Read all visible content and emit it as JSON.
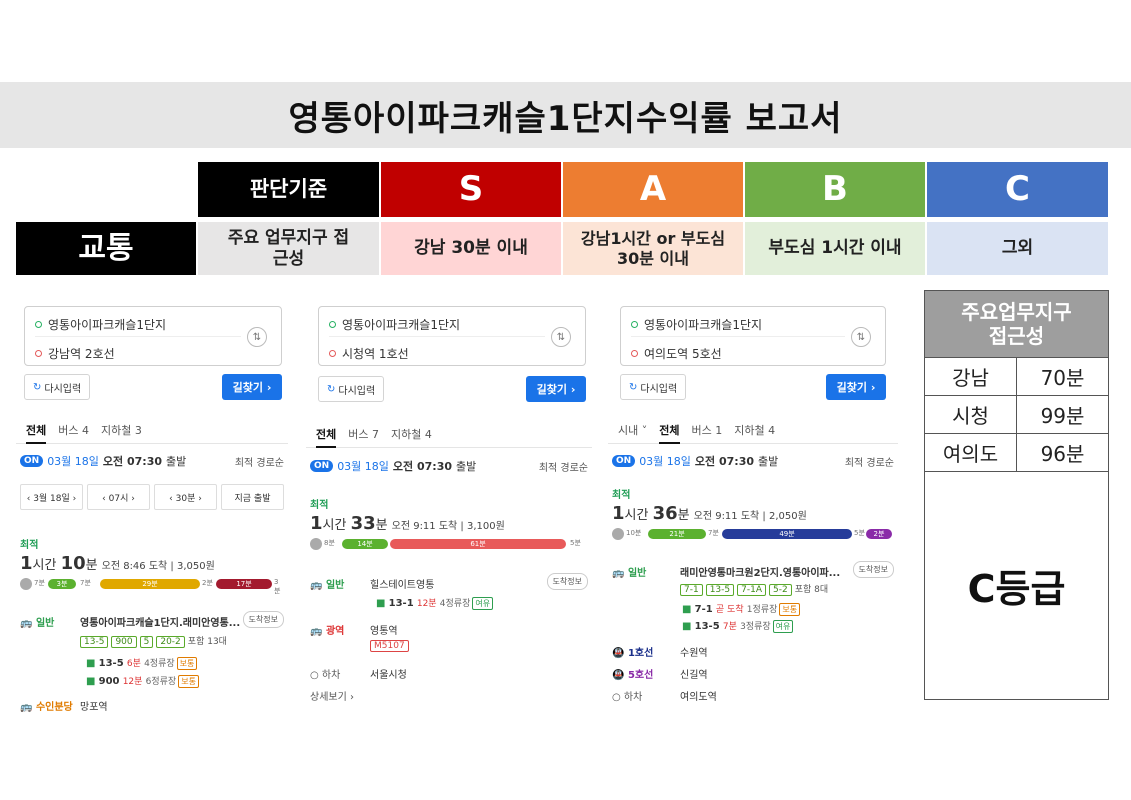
{
  "title": "영통아이파크캐슬1단지수익률 보고서",
  "criteria_header": {
    "label": "판단기준",
    "grades": [
      "S",
      "A",
      "B",
      "C"
    ],
    "colors": [
      "#000000",
      "#c00000",
      "#ed7d31",
      "#70ad47",
      "#4472c4"
    ]
  },
  "transport_row": {
    "category": "교통",
    "criterion": "주요 업무지구 접근성",
    "s": "강남 30분 이내",
    "a": "강남1시간 or 부도심 30분 이내",
    "b": "부도심 1시간 이내",
    "c": "그외"
  },
  "panels": [
    {
      "from": "영통아이파크캐슬1단지",
      "to": "강남역 2호선",
      "reset": "다시입력",
      "go": "길찾기 ›",
      "tabs": [
        "전체",
        "버스 4",
        "지하철 3"
      ],
      "on": "ON",
      "depart_date": "03월 18일",
      "depart_time": "오전 07:30",
      "depart_suffix": "출발",
      "sort": "최적 경로순",
      "picker": [
        "‹ 3월 18일 ›",
        "‹ 07시 ›",
        "‹ 30분 ›",
        "지금 출발"
      ],
      "best": "최적",
      "hours": "1",
      "minutes": "10",
      "arrival": "오전 8:46 도착",
      "fare": "3,050원",
      "bar_labels": [
        "7분",
        "3분",
        "7분",
        "29분",
        "2분",
        "17분",
        "3분"
      ],
      "legs": [
        {
          "label": "일반",
          "value": "영통아이파크캐슬1단지.래미안영통...",
          "chips": [
            "13-5",
            "900",
            "5",
            "20-2"
          ],
          "extra": "포함 13대",
          "arrive_btn": "도착정보"
        },
        {
          "bus": "13-5",
          "wait": "6분",
          "stops": "4정류장",
          "status": "보통"
        },
        {
          "bus": "900",
          "wait": "12분",
          "stops": "6정류장",
          "status": "보통"
        },
        {
          "label": "수인분당",
          "value": "망포역"
        }
      ]
    },
    {
      "from": "영통아이파크캐슬1단지",
      "to": "시청역 1호선",
      "reset": "다시입력",
      "go": "길찾기 ›",
      "tabs": [
        "전체",
        "버스 7",
        "지하철 4"
      ],
      "on": "ON",
      "depart_date": "03월 18일",
      "depart_time": "오전 07:30",
      "depart_suffix": "출발",
      "sort": "최적 경로순",
      "best": "최적",
      "hours": "1",
      "minutes": "33",
      "arrival": "오전 9:11 도착",
      "fare": "3,100원",
      "bar_labels": [
        "8분",
        "14분",
        "61분",
        "5분"
      ],
      "legs": [
        {
          "label": "일반",
          "value": "힐스테이트영통",
          "arrive_btn": "도착정보"
        },
        {
          "bus": "13-1",
          "wait": "12분",
          "stops": "4정류장",
          "status": "여유"
        },
        {
          "label": "광역",
          "value": "영통역",
          "chip": "M5107"
        },
        {
          "label": "하차",
          "value": "서울시청"
        },
        {
          "more": "상세보기 ›"
        }
      ]
    },
    {
      "from": "영통아이파크캐슬1단지",
      "to": "여의도역 5호선",
      "reset": "다시입력",
      "go": "길찾기 ›",
      "tabs": [
        "시내 ˅",
        "전체",
        "버스 1",
        "지하철 4"
      ],
      "on": "ON",
      "depart_date": "03월 18일",
      "depart_time": "오전 07:30",
      "depart_suffix": "출발",
      "sort": "최적 경로순",
      "best": "최적",
      "hours": "1",
      "minutes": "36",
      "arrival": "오전 9:11 도착",
      "fare": "2,050원",
      "bar_labels": [
        "10분",
        "21분",
        "7분",
        "49분",
        "5분",
        "2분"
      ],
      "legs": [
        {
          "label": "일반",
          "value": "래미안영통마크원2단지.영통아이파...",
          "chips": [
            "7-1",
            "13-5",
            "7-1A",
            "5-2"
          ],
          "extra": "포함 8대",
          "arrive_btn": "도착정보"
        },
        {
          "bus": "7-1",
          "wait": "곧 도착",
          "stops": "1정류장",
          "status": "보통"
        },
        {
          "bus": "13-5",
          "wait": "7분",
          "stops": "3정류장",
          "status": "여유"
        },
        {
          "label": "1호선",
          "value": "수원역"
        },
        {
          "label": "5호선",
          "value": "신길역"
        },
        {
          "label": "하차",
          "value": "여의도역"
        }
      ]
    }
  ],
  "access_table": {
    "header": "주요업무지구 접근성",
    "rows": [
      {
        "place": "강남",
        "time": "70분"
      },
      {
        "place": "시청",
        "time": "99분"
      },
      {
        "place": "여의도",
        "time": "96분"
      }
    ],
    "grade": "C등급"
  },
  "icons": [
    "swap-icon",
    "refresh-icon",
    "bus-icon",
    "subway-icon",
    "walk-icon"
  ]
}
